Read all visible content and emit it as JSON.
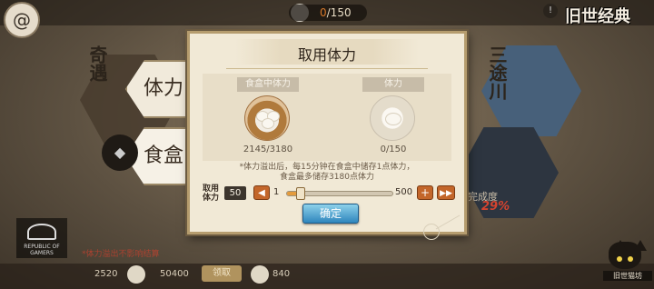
{
  "header": {
    "resource_current": "0",
    "resource_total": "/150",
    "logo_text": "旧世经典"
  },
  "left_side": {
    "bg_title": "奇遇",
    "tabs": [
      {
        "label": "体力"
      },
      {
        "label": "食盒"
      }
    ]
  },
  "right_side": {
    "bg_title": "三途川",
    "complete_label": "完成度",
    "complete_value": "29%"
  },
  "dialog": {
    "title": "取用体力",
    "box_label": "食盒中体力",
    "box_value": "2145/3180",
    "stamina_label": "体力",
    "stamina_value": "0/150",
    "note_line1": "*体力溢出后，每15分钟在食盒中储存1点体力，",
    "note_line2": "食盒最多储存3180点体力",
    "take_label": "取用体力",
    "take_value": "50",
    "slider": {
      "min": "1",
      "max": "500",
      "value": 50,
      "range_min": 1,
      "range_max": 500
    },
    "minus_symbol": "◀",
    "plus_symbol": "+",
    "max_symbol": "▶▶",
    "confirm_label": "确定"
  },
  "watermark": {
    "line1": "REPUBLIC OF",
    "line2": "GAMERS"
  },
  "bottom": {
    "hint": "*体力溢出不影响结算",
    "val1": "2520",
    "val2": "50400",
    "btn_label": "领取",
    "val3": "840",
    "cat_label": "旧世猫坊"
  },
  "colors": {
    "accent_orange": "#c3662a",
    "confirm_blue": "#2f86bd",
    "dialog_bg": "#f1e9d6",
    "percent_red": "#d3432f"
  }
}
